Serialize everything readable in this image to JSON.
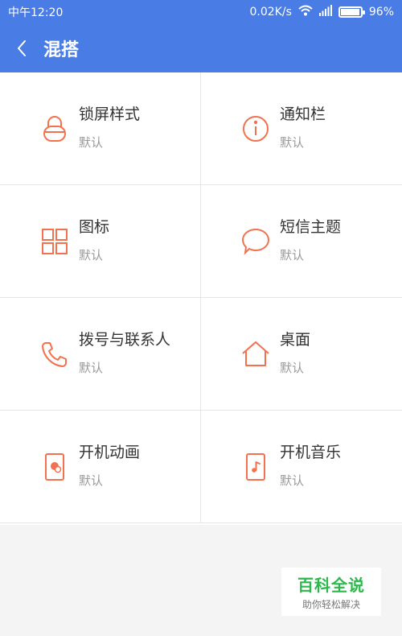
{
  "status_bar": {
    "time": "中午12:20",
    "network_speed": "0.02K/s",
    "battery": "96%",
    "battery_level": 0.96
  },
  "title_bar": {
    "title": "混搭",
    "back_icon": "chevron-left-icon"
  },
  "items": [
    {
      "name": "锁屏样式",
      "value": "默认",
      "icon": "lock-icon"
    },
    {
      "name": "通知栏",
      "value": "默认",
      "icon": "info-icon"
    },
    {
      "name": "图标",
      "value": "默认",
      "icon": "grid-icon"
    },
    {
      "name": "短信主题",
      "value": "默认",
      "icon": "chat-bubble-icon"
    },
    {
      "name": "拨号与联系人",
      "value": "默认",
      "icon": "phone-icon"
    },
    {
      "name": "桌面",
      "value": "默认",
      "icon": "home-icon"
    },
    {
      "name": "开机动画",
      "value": "默认",
      "icon": "boot-animation-icon"
    },
    {
      "name": "开机音乐",
      "value": "默认",
      "icon": "music-note-icon"
    }
  ],
  "watermark": {
    "title": "百科全说",
    "subtitle": "助你轻松解决"
  },
  "colors": {
    "accent": "#4a7ce5",
    "icon": "#f2724f",
    "watermark": "#2db84d"
  }
}
